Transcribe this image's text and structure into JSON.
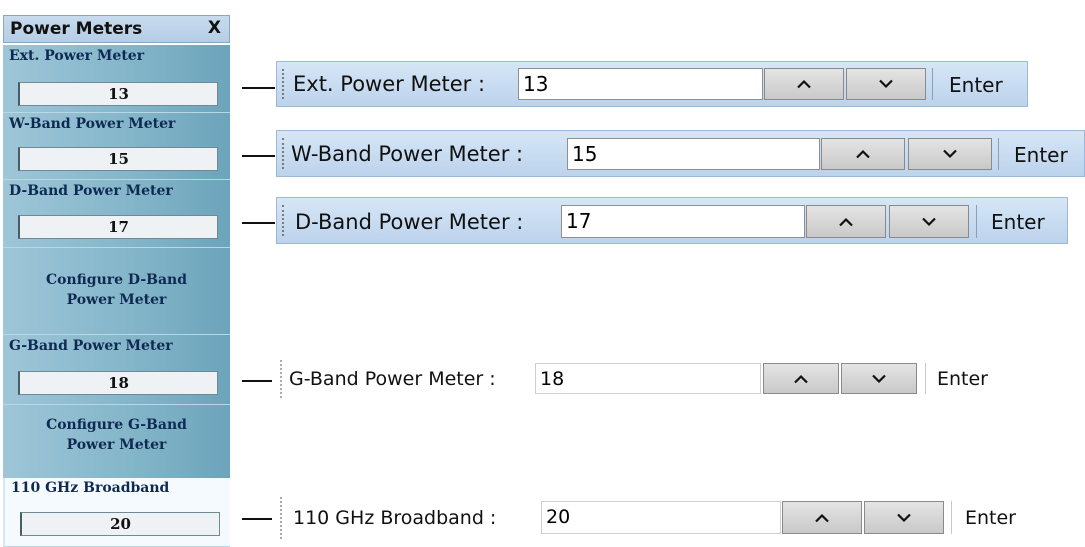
{
  "panel": {
    "title": "Power Meters",
    "close_label": "X",
    "items": [
      {
        "label": "Ext. Power Meter",
        "value": "13"
      },
      {
        "label": "W-Band Power Meter",
        "value": "15"
      },
      {
        "label": "D-Band Power Meter",
        "value": "17"
      },
      {
        "label": "G-Band Power Meter",
        "value": "18"
      },
      {
        "label": "110 GHz Broadband",
        "value": "20"
      }
    ],
    "config_d": {
      "line1": "Configure D-Band",
      "line2": "Power Meter"
    },
    "config_g": {
      "line1": "Configure G-Band",
      "line2": "Power Meter"
    }
  },
  "toolbars": [
    {
      "label": "Ext. Power Meter :",
      "value": "13",
      "enter": "Enter"
    },
    {
      "label": "W-Band Power Meter :",
      "value": "15",
      "enter": "Enter"
    },
    {
      "label": "D-Band Power Meter :",
      "value": "17",
      "enter": "Enter"
    },
    {
      "label": "G-Band Power Meter :",
      "value": "18",
      "enter": "Enter"
    },
    {
      "label": "110 GHz Broadband :",
      "value": "20",
      "enter": "Enter"
    }
  ],
  "icons": {
    "up": "chevron-up-icon",
    "down": "chevron-down-icon",
    "grip": "toolbar-grip-icon"
  },
  "colors": {
    "panel_title_bg": "#bcd3ec",
    "panel_body_bg": "#82b4c8",
    "toolbar_bg": "#c8dcf0"
  }
}
